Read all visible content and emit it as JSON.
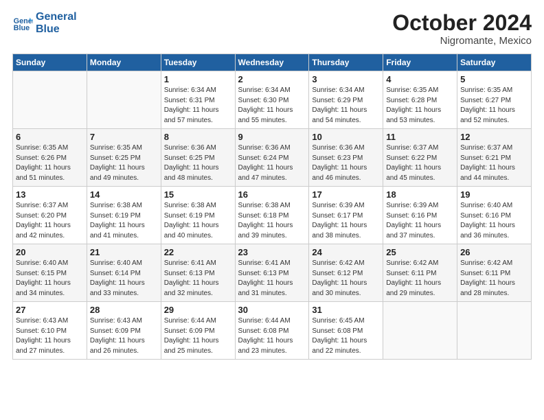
{
  "header": {
    "logo_line1": "General",
    "logo_line2": "Blue",
    "month": "October 2024",
    "location": "Nigromante, Mexico"
  },
  "weekdays": [
    "Sunday",
    "Monday",
    "Tuesday",
    "Wednesday",
    "Thursday",
    "Friday",
    "Saturday"
  ],
  "weeks": [
    [
      {
        "day": "",
        "info": ""
      },
      {
        "day": "",
        "info": ""
      },
      {
        "day": "1",
        "info": "Sunrise: 6:34 AM\nSunset: 6:31 PM\nDaylight: 11 hours and 57 minutes."
      },
      {
        "day": "2",
        "info": "Sunrise: 6:34 AM\nSunset: 6:30 PM\nDaylight: 11 hours and 55 minutes."
      },
      {
        "day": "3",
        "info": "Sunrise: 6:34 AM\nSunset: 6:29 PM\nDaylight: 11 hours and 54 minutes."
      },
      {
        "day": "4",
        "info": "Sunrise: 6:35 AM\nSunset: 6:28 PM\nDaylight: 11 hours and 53 minutes."
      },
      {
        "day": "5",
        "info": "Sunrise: 6:35 AM\nSunset: 6:27 PM\nDaylight: 11 hours and 52 minutes."
      }
    ],
    [
      {
        "day": "6",
        "info": "Sunrise: 6:35 AM\nSunset: 6:26 PM\nDaylight: 11 hours and 51 minutes."
      },
      {
        "day": "7",
        "info": "Sunrise: 6:35 AM\nSunset: 6:25 PM\nDaylight: 11 hours and 49 minutes."
      },
      {
        "day": "8",
        "info": "Sunrise: 6:36 AM\nSunset: 6:25 PM\nDaylight: 11 hours and 48 minutes."
      },
      {
        "day": "9",
        "info": "Sunrise: 6:36 AM\nSunset: 6:24 PM\nDaylight: 11 hours and 47 minutes."
      },
      {
        "day": "10",
        "info": "Sunrise: 6:36 AM\nSunset: 6:23 PM\nDaylight: 11 hours and 46 minutes."
      },
      {
        "day": "11",
        "info": "Sunrise: 6:37 AM\nSunset: 6:22 PM\nDaylight: 11 hours and 45 minutes."
      },
      {
        "day": "12",
        "info": "Sunrise: 6:37 AM\nSunset: 6:21 PM\nDaylight: 11 hours and 44 minutes."
      }
    ],
    [
      {
        "day": "13",
        "info": "Sunrise: 6:37 AM\nSunset: 6:20 PM\nDaylight: 11 hours and 42 minutes."
      },
      {
        "day": "14",
        "info": "Sunrise: 6:38 AM\nSunset: 6:19 PM\nDaylight: 11 hours and 41 minutes."
      },
      {
        "day": "15",
        "info": "Sunrise: 6:38 AM\nSunset: 6:19 PM\nDaylight: 11 hours and 40 minutes."
      },
      {
        "day": "16",
        "info": "Sunrise: 6:38 AM\nSunset: 6:18 PM\nDaylight: 11 hours and 39 minutes."
      },
      {
        "day": "17",
        "info": "Sunrise: 6:39 AM\nSunset: 6:17 PM\nDaylight: 11 hours and 38 minutes."
      },
      {
        "day": "18",
        "info": "Sunrise: 6:39 AM\nSunset: 6:16 PM\nDaylight: 11 hours and 37 minutes."
      },
      {
        "day": "19",
        "info": "Sunrise: 6:40 AM\nSunset: 6:16 PM\nDaylight: 11 hours and 36 minutes."
      }
    ],
    [
      {
        "day": "20",
        "info": "Sunrise: 6:40 AM\nSunset: 6:15 PM\nDaylight: 11 hours and 34 minutes."
      },
      {
        "day": "21",
        "info": "Sunrise: 6:40 AM\nSunset: 6:14 PM\nDaylight: 11 hours and 33 minutes."
      },
      {
        "day": "22",
        "info": "Sunrise: 6:41 AM\nSunset: 6:13 PM\nDaylight: 11 hours and 32 minutes."
      },
      {
        "day": "23",
        "info": "Sunrise: 6:41 AM\nSunset: 6:13 PM\nDaylight: 11 hours and 31 minutes."
      },
      {
        "day": "24",
        "info": "Sunrise: 6:42 AM\nSunset: 6:12 PM\nDaylight: 11 hours and 30 minutes."
      },
      {
        "day": "25",
        "info": "Sunrise: 6:42 AM\nSunset: 6:11 PM\nDaylight: 11 hours and 29 minutes."
      },
      {
        "day": "26",
        "info": "Sunrise: 6:42 AM\nSunset: 6:11 PM\nDaylight: 11 hours and 28 minutes."
      }
    ],
    [
      {
        "day": "27",
        "info": "Sunrise: 6:43 AM\nSunset: 6:10 PM\nDaylight: 11 hours and 27 minutes."
      },
      {
        "day": "28",
        "info": "Sunrise: 6:43 AM\nSunset: 6:09 PM\nDaylight: 11 hours and 26 minutes."
      },
      {
        "day": "29",
        "info": "Sunrise: 6:44 AM\nSunset: 6:09 PM\nDaylight: 11 hours and 25 minutes."
      },
      {
        "day": "30",
        "info": "Sunrise: 6:44 AM\nSunset: 6:08 PM\nDaylight: 11 hours and 23 minutes."
      },
      {
        "day": "31",
        "info": "Sunrise: 6:45 AM\nSunset: 6:08 PM\nDaylight: 11 hours and 22 minutes."
      },
      {
        "day": "",
        "info": ""
      },
      {
        "day": "",
        "info": ""
      }
    ]
  ]
}
